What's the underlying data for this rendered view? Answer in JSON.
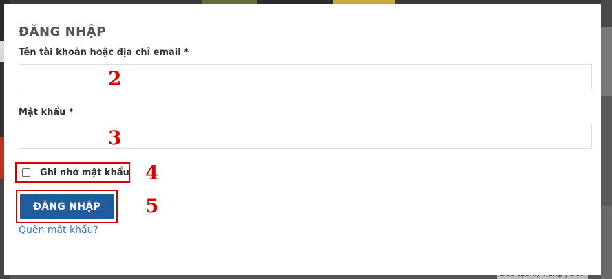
{
  "login_form": {
    "title": "ĐĂNG NHẬP",
    "username_label": "Tên tài khoản hoặc địa chỉ email *",
    "username_value": "",
    "password_label": "Mật khẩu *",
    "password_value": "",
    "remember_label": "Ghi nhớ mật khẩu",
    "remember_checked": false,
    "submit_label": "ĐĂNG NHẬP",
    "forgot_link": "Quên mật khẩu?"
  },
  "annotations": {
    "n2": "2",
    "n3": "3",
    "n4": "4",
    "n5": "5",
    "color": "#e00000"
  },
  "background": {
    "partial_text": "Đào tạo kỹ năng | Đơn"
  },
  "colors": {
    "button": "#1f5d9e",
    "link": "#3a7bbf",
    "highlight_border": "#d40000"
  }
}
